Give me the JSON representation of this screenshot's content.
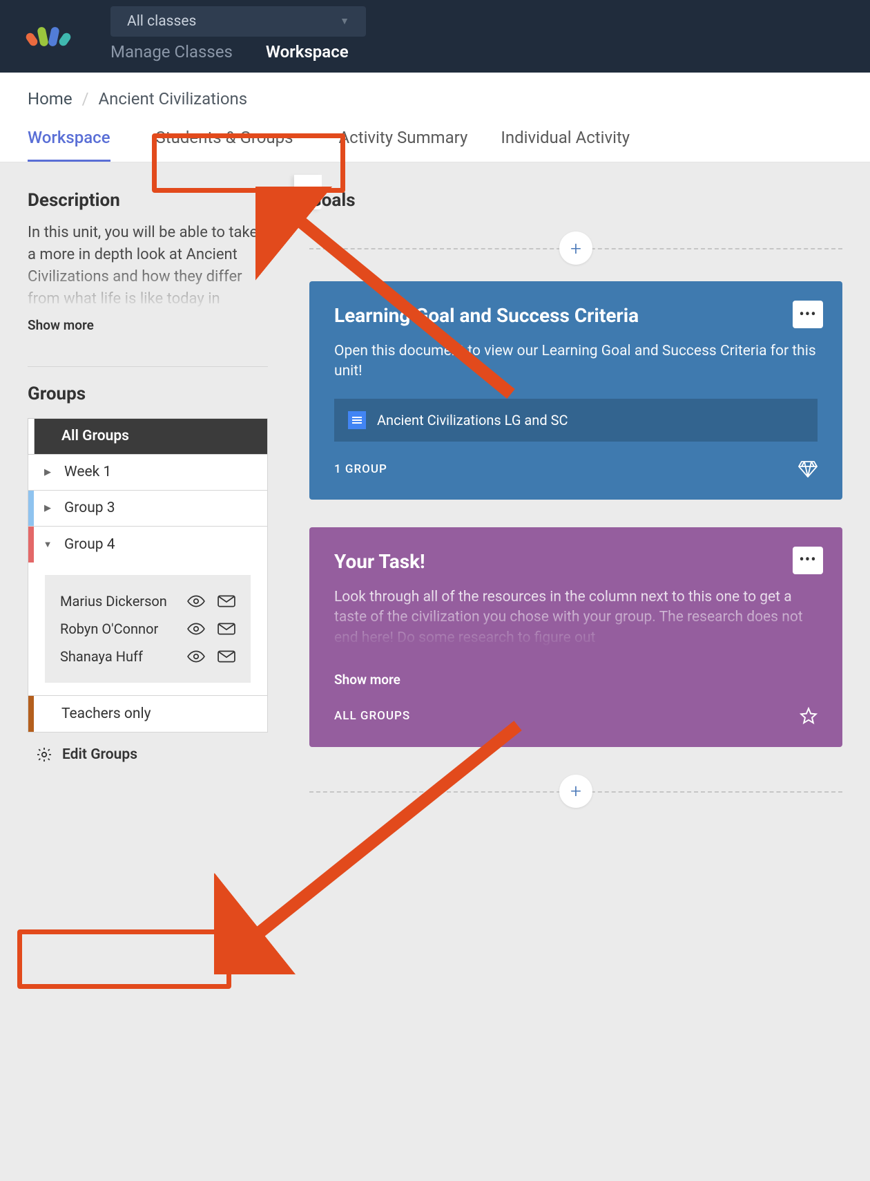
{
  "nav": {
    "class_selector": "All classes",
    "tabs": {
      "manage": "Manage Classes",
      "workspace": "Workspace"
    }
  },
  "breadcrumb": {
    "home": "Home",
    "current": "Ancient Civilizations"
  },
  "page_tabs": {
    "workspace": "Workspace",
    "students_groups": "Students & Groups",
    "activity_summary": "Activity Summary",
    "individual_activity": "Individual Activity"
  },
  "sidebar": {
    "description_title": "Description",
    "description_text": "In this unit, you will be able to take a more in depth look at Ancient Civilizations and how they differ from what life is like today in",
    "show_more": "Show more",
    "groups_title": "Groups",
    "groups": {
      "all": "All Groups",
      "week1": "Week 1",
      "group3": "Group 3",
      "group4": "Group 4",
      "teachers_only": "Teachers only"
    },
    "members": [
      {
        "name": "Marius Dickerson"
      },
      {
        "name": "Robyn O'Connor"
      },
      {
        "name": "Shanaya Huff"
      }
    ],
    "edit_groups": "Edit Groups"
  },
  "colors": {
    "stripe_week1": "#b98fe0",
    "stripe_group3": "#8fc3ef",
    "stripe_group4": "#e36868",
    "stripe_teachers": "#b45f1d"
  },
  "goals": {
    "title": "Goals",
    "card1": {
      "title": "Learning Goal and Success Criteria",
      "body": "Open this document to view our Learning Goal and Success Criteria for this unit!",
      "attachment": "Ancient Civilizations LG and SC",
      "footer": "1 GROUP"
    },
    "card2": {
      "title": "Your Task!",
      "body": "Look through all of the resources in the column next to this one to get a taste of the civilization you chose with your group. The research does not end here! Do some research to figure out",
      "show_more": "Show more",
      "footer": "ALL GROUPS"
    }
  }
}
